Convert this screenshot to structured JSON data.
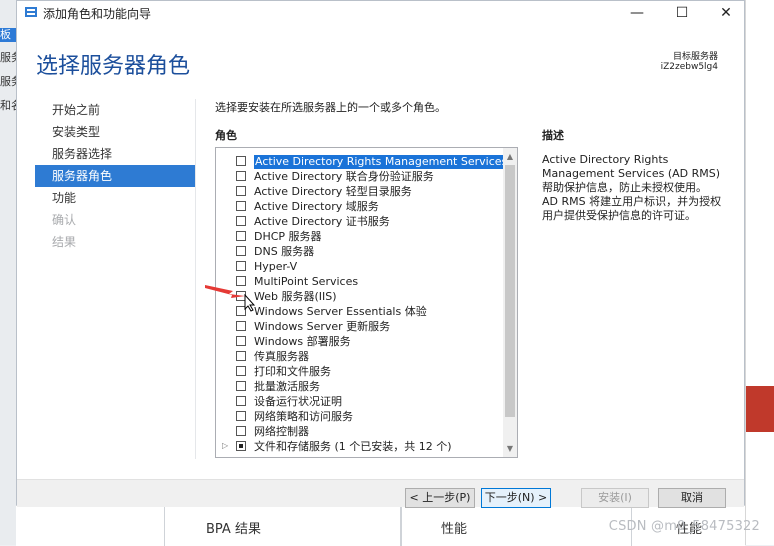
{
  "background": {
    "left_texts": [
      "板",
      "服务",
      "服务",
      "和名"
    ],
    "bottom_labels": [
      "BPA 结果",
      "性能",
      "性能"
    ],
    "watermark": "CSDN @m0_58475322"
  },
  "window": {
    "title": "添加角色和功能向导",
    "controls": {
      "minimize": "—",
      "maximize": "☐",
      "close": "✕"
    }
  },
  "header": {
    "heading": "选择服务器角色",
    "target_server_label": "目标服务器",
    "target_server_value": "iZ2zebw5lg4"
  },
  "nav": {
    "items": [
      {
        "label": "开始之前",
        "state": "normal"
      },
      {
        "label": "安装类型",
        "state": "normal"
      },
      {
        "label": "服务器选择",
        "state": "normal"
      },
      {
        "label": "服务器角色",
        "state": "active"
      },
      {
        "label": "功能",
        "state": "normal"
      },
      {
        "label": "确认",
        "state": "disabled"
      },
      {
        "label": "结果",
        "state": "disabled"
      }
    ]
  },
  "main": {
    "instruction": "选择要安装在所选服务器上的一个或多个角色。",
    "roles_header": "角色",
    "description_header": "描述",
    "roles": [
      {
        "label": "Active Directory Rights Management Services",
        "checked": false,
        "selected": true
      },
      {
        "label": "Active Directory 联合身份验证服务",
        "checked": false
      },
      {
        "label": "Active Directory 轻型目录服务",
        "checked": false
      },
      {
        "label": "Active Directory 域服务",
        "checked": false
      },
      {
        "label": "Active Directory 证书服务",
        "checked": false
      },
      {
        "label": "DHCP 服务器",
        "checked": false
      },
      {
        "label": "DNS 服务器",
        "checked": false
      },
      {
        "label": "Hyper-V",
        "checked": false
      },
      {
        "label": "MultiPoint Services",
        "checked": false
      },
      {
        "label": "Web 服务器(IIS)",
        "checked": false
      },
      {
        "label": "Windows Server Essentials 体验",
        "checked": false
      },
      {
        "label": "Windows Server 更新服务",
        "checked": false
      },
      {
        "label": "Windows 部署服务",
        "checked": false
      },
      {
        "label": "传真服务器",
        "checked": false
      },
      {
        "label": "打印和文件服务",
        "checked": false
      },
      {
        "label": "批量激活服务",
        "checked": false
      },
      {
        "label": "设备运行状况证明",
        "checked": false
      },
      {
        "label": "网络策略和访问服务",
        "checked": false
      },
      {
        "label": "网络控制器",
        "checked": false
      },
      {
        "label": "文件和存储服务 (1 个已安装，共 12 个)",
        "checked": "partial",
        "expandable": true
      }
    ],
    "description_lines": [
      "Active Directory Rights",
      "Management Services (AD RMS)",
      "帮助保护信息，防止未授权使用。",
      "AD RMS 将建立用户标识，并为授权",
      "用户提供受保护信息的许可证。"
    ]
  },
  "footer": {
    "prev_button": "< 上一步(P)",
    "next_button": "下一步(N) >",
    "install_button": "安装(I)",
    "cancel_button": "取消"
  },
  "colors": {
    "accent": "#2e7bd3",
    "heading": "#1c4f9c",
    "selection": "#1a73d8",
    "arrow": "#e53935"
  }
}
